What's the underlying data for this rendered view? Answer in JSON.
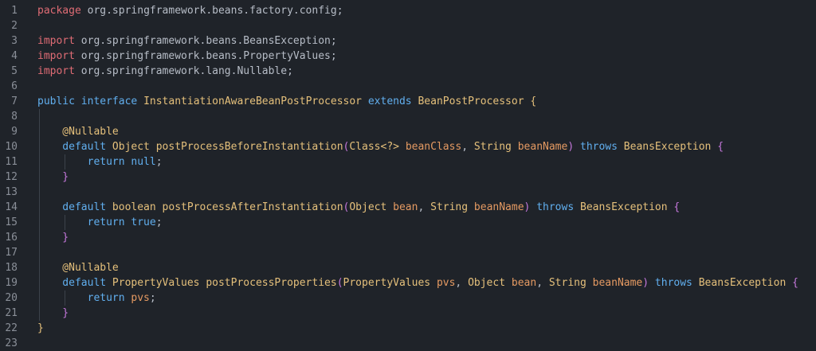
{
  "editor": {
    "lines": [
      {
        "no": "1",
        "tokens": [
          {
            "t": "package",
            "c": "#e06c75"
          },
          {
            "t": " org.springframework.beans.factory.config;",
            "c": "#b7bdc7"
          }
        ]
      },
      {
        "no": "2",
        "tokens": []
      },
      {
        "no": "3",
        "tokens": [
          {
            "t": "import",
            "c": "#e06c75"
          },
          {
            "t": " org.springframework.beans.BeansException;",
            "c": "#b7bdc7"
          }
        ]
      },
      {
        "no": "4",
        "tokens": [
          {
            "t": "import",
            "c": "#e06c75"
          },
          {
            "t": " org.springframework.beans.PropertyValues;",
            "c": "#b7bdc7"
          }
        ]
      },
      {
        "no": "5",
        "tokens": [
          {
            "t": "import",
            "c": "#e06c75"
          },
          {
            "t": " org.springframework.lang.Nullable;",
            "c": "#b7bdc7"
          }
        ]
      },
      {
        "no": "6",
        "tokens": []
      },
      {
        "no": "7",
        "tokens": [
          {
            "t": "public",
            "c": "#61afef"
          },
          {
            "t": " ",
            "c": "#b7bdc7"
          },
          {
            "t": "interface",
            "c": "#61afef"
          },
          {
            "t": " InstantiationAwareBeanPostProcessor ",
            "c": "#e5c07b"
          },
          {
            "t": "extends",
            "c": "#61afef"
          },
          {
            "t": " BeanPostProcessor ",
            "c": "#e5c07b"
          },
          {
            "t": "{",
            "c": "#e5c07b"
          }
        ]
      },
      {
        "no": "8",
        "tokens": []
      },
      {
        "no": "9",
        "tokens": [
          {
            "t": "    @Nullable",
            "c": "#e5c07b"
          }
        ]
      },
      {
        "no": "10",
        "tokens": [
          {
            "t": "    default ",
            "c": "#61afef"
          },
          {
            "t": "Object ",
            "c": "#e5c07b"
          },
          {
            "t": "postProcessBeforeInstantiation",
            "c": "#e5c07b"
          },
          {
            "t": "(",
            "c": "#c678dd"
          },
          {
            "t": "Class<?> ",
            "c": "#e5c07b"
          },
          {
            "t": "beanClass",
            "c": "#e59a62"
          },
          {
            "t": ", ",
            "c": "#b7bdc7"
          },
          {
            "t": "String ",
            "c": "#e5c07b"
          },
          {
            "t": "beanName",
            "c": "#e59a62"
          },
          {
            "t": ") ",
            "c": "#c678dd"
          },
          {
            "t": "throws ",
            "c": "#61afef"
          },
          {
            "t": "BeansException ",
            "c": "#e5c07b"
          },
          {
            "t": "{",
            "c": "#c678dd"
          }
        ]
      },
      {
        "no": "11",
        "tokens": [
          {
            "t": "        return ",
            "c": "#61afef"
          },
          {
            "t": "null",
            "c": "#61afef"
          },
          {
            "t": ";",
            "c": "#b7bdc7"
          }
        ]
      },
      {
        "no": "12",
        "tokens": [
          {
            "t": "    }",
            "c": "#c678dd"
          }
        ]
      },
      {
        "no": "13",
        "tokens": []
      },
      {
        "no": "14",
        "tokens": [
          {
            "t": "    default ",
            "c": "#61afef"
          },
          {
            "t": "boolean ",
            "c": "#e5c07b"
          },
          {
            "t": "postProcessAfterInstantiation",
            "c": "#e5c07b"
          },
          {
            "t": "(",
            "c": "#c678dd"
          },
          {
            "t": "Object ",
            "c": "#e5c07b"
          },
          {
            "t": "bean",
            "c": "#e59a62"
          },
          {
            "t": ", ",
            "c": "#b7bdc7"
          },
          {
            "t": "String ",
            "c": "#e5c07b"
          },
          {
            "t": "beanName",
            "c": "#e59a62"
          },
          {
            "t": ") ",
            "c": "#c678dd"
          },
          {
            "t": "throws ",
            "c": "#61afef"
          },
          {
            "t": "BeansException ",
            "c": "#e5c07b"
          },
          {
            "t": "{",
            "c": "#c678dd"
          }
        ]
      },
      {
        "no": "15",
        "tokens": [
          {
            "t": "        return ",
            "c": "#61afef"
          },
          {
            "t": "true",
            "c": "#61afef"
          },
          {
            "t": ";",
            "c": "#b7bdc7"
          }
        ]
      },
      {
        "no": "16",
        "tokens": [
          {
            "t": "    }",
            "c": "#c678dd"
          }
        ]
      },
      {
        "no": "17",
        "tokens": []
      },
      {
        "no": "18",
        "tokens": [
          {
            "t": "    @Nullable",
            "c": "#e5c07b"
          }
        ]
      },
      {
        "no": "19",
        "tokens": [
          {
            "t": "    default ",
            "c": "#61afef"
          },
          {
            "t": "PropertyValues ",
            "c": "#e5c07b"
          },
          {
            "t": "postProcessProperties",
            "c": "#e5c07b"
          },
          {
            "t": "(",
            "c": "#c678dd"
          },
          {
            "t": "PropertyValues ",
            "c": "#e5c07b"
          },
          {
            "t": "pvs",
            "c": "#e59a62"
          },
          {
            "t": ", ",
            "c": "#b7bdc7"
          },
          {
            "t": "Object ",
            "c": "#e5c07b"
          },
          {
            "t": "bean",
            "c": "#e59a62"
          },
          {
            "t": ", ",
            "c": "#b7bdc7"
          },
          {
            "t": "String ",
            "c": "#e5c07b"
          },
          {
            "t": "beanName",
            "c": "#e59a62"
          },
          {
            "t": ") ",
            "c": "#c678dd"
          },
          {
            "t": "throws ",
            "c": "#61afef"
          },
          {
            "t": "BeansException ",
            "c": "#e5c07b"
          },
          {
            "t": "{",
            "c": "#c678dd"
          }
        ]
      },
      {
        "no": "20",
        "tokens": [
          {
            "t": "        return ",
            "c": "#61afef"
          },
          {
            "t": "pvs",
            "c": "#e59a62"
          },
          {
            "t": ";",
            "c": "#b7bdc7"
          }
        ]
      },
      {
        "no": "21",
        "tokens": [
          {
            "t": "    }",
            "c": "#c678dd"
          }
        ]
      },
      {
        "no": "22",
        "tokens": [
          {
            "t": "}",
            "c": "#e5c07b"
          }
        ]
      },
      {
        "no": "23",
        "tokens": []
      }
    ]
  }
}
